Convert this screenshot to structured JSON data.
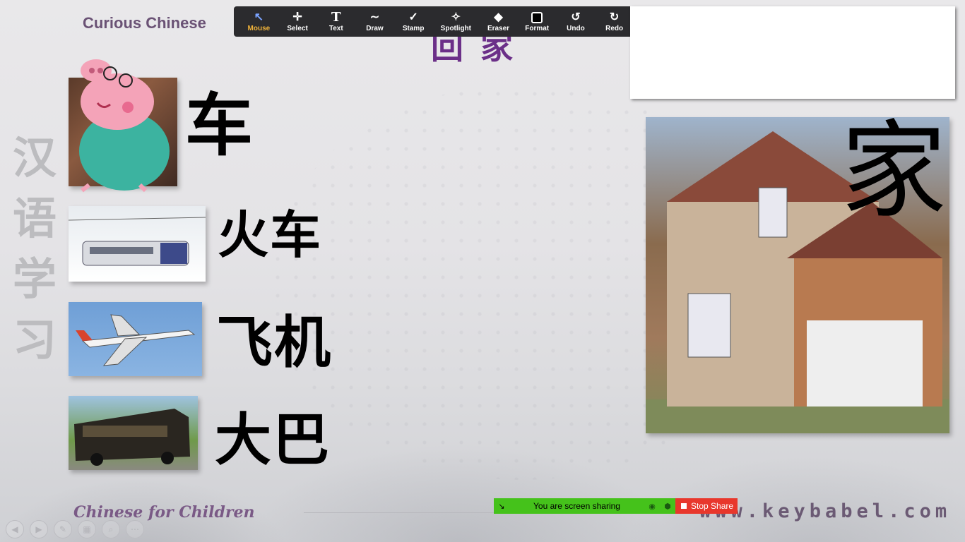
{
  "slide": {
    "brand_top": "Curious Chinese",
    "title": "回家",
    "side_chars": [
      "汉",
      "语",
      "学",
      "习"
    ],
    "brand_bottom": "Chinese for Children",
    "website": "www.keybabel.com"
  },
  "toolbar": {
    "tools": [
      {
        "label": "Mouse",
        "icon": "mouse-pointer-icon",
        "active": true
      },
      {
        "label": "Select",
        "icon": "move-arrows-icon"
      },
      {
        "label": "Text",
        "icon": "text-icon"
      },
      {
        "label": "Draw",
        "icon": "draw-wave-icon"
      },
      {
        "label": "Stamp",
        "icon": "checkmark-icon"
      },
      {
        "label": "Spotlight",
        "icon": "spotlight-wand-icon"
      },
      {
        "label": "Eraser",
        "icon": "eraser-icon"
      },
      {
        "label": "Format",
        "icon": "color-swatch-icon",
        "color": "#000000"
      },
      {
        "label": "Undo",
        "icon": "undo-icon"
      },
      {
        "label": "Redo",
        "icon": "redo-icon"
      }
    ]
  },
  "vocab": {
    "car": "车",
    "train": "火车",
    "plane": "飞机",
    "bus": "大巴",
    "home": "家"
  },
  "share": {
    "status": "You are screen sharing",
    "stop_label": "Stop Share",
    "status_color": "#45c21b",
    "stop_color": "#e8372c"
  }
}
